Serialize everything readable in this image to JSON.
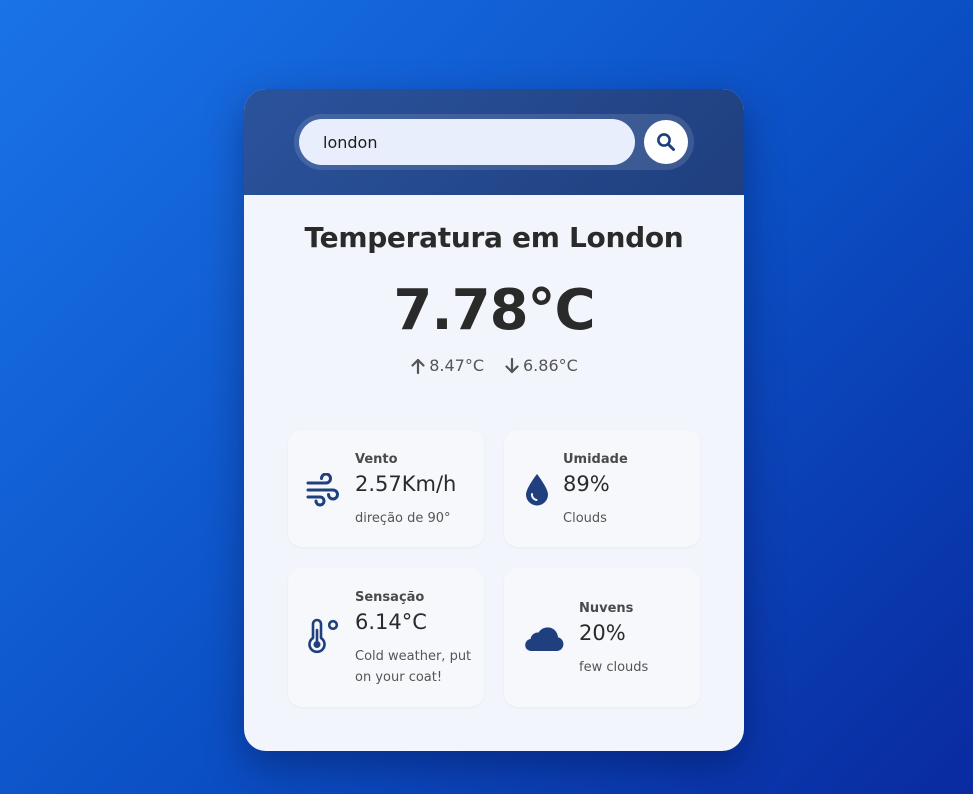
{
  "search": {
    "value": "london",
    "button_icon": "search-icon"
  },
  "weather": {
    "title": "Temperatura em London",
    "temperature": "7.78°C",
    "max": "8.47°C",
    "min": "6.86°C",
    "max_icon": "arrow-up-icon",
    "min_icon": "arrow-down-icon"
  },
  "tiles": {
    "wind": {
      "icon": "wind-icon",
      "label": "Vento",
      "value": "2.57Km/h",
      "sub": "direção de 90°"
    },
    "humidity": {
      "icon": "water-drop-icon",
      "label": "Umidade",
      "value": "89%",
      "sub": "Clouds"
    },
    "feels": {
      "icon": "thermometer-icon",
      "label": "Sensação",
      "value": "6.14°C",
      "sub": "Cold weather, put on your coat!"
    },
    "clouds": {
      "icon": "cloud-icon",
      "label": "Nuvens",
      "value": "20%",
      "sub": "few clouds"
    }
  },
  "colors": {
    "accent": "#1f3f7e",
    "background_start": "#1a73e8",
    "background_end": "#0a2aa0",
    "card": "#f2f5fb",
    "icon": "#1f3f7e"
  }
}
